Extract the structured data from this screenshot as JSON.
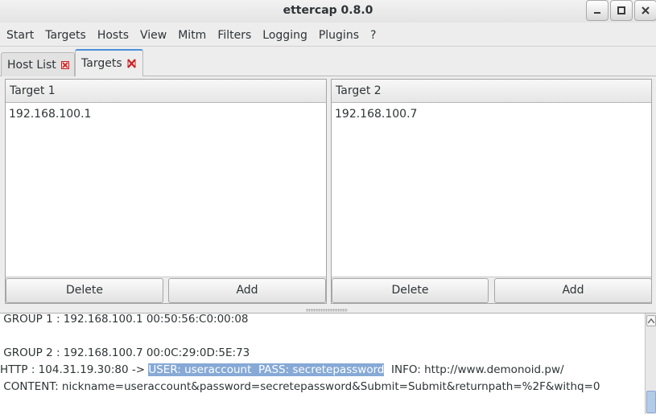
{
  "window": {
    "title": "ettercap 0.8.0",
    "controls": [
      "minimize-icon",
      "maximize-icon",
      "close-icon"
    ]
  },
  "menu": [
    "Start",
    "Targets",
    "Hosts",
    "View",
    "Mitm",
    "Filters",
    "Logging",
    "Plugins",
    "?"
  ],
  "tabs": [
    {
      "label": "Host List",
      "active": false
    },
    {
      "label": "Targets",
      "active": true
    }
  ],
  "target1": {
    "header": "Target 1",
    "items": [
      "192.168.100.1"
    ],
    "delete_label": "Delete",
    "add_label": "Add"
  },
  "target2": {
    "header": "Target 2",
    "items": [
      "192.168.100.7"
    ],
    "delete_label": "Delete",
    "add_label": "Add"
  },
  "console": {
    "line1": " GROUP 1 : 192.168.100.1 00:50:56:C0:00:08",
    "line2": " GROUP 2 : 192.168.100.7 00:0C:29:0D:5E:73",
    "line3_prefix": "HTTP : 104.31.19.30:80 -> ",
    "line3_highlight": "USER: useraccount  PASS: secretepassword",
    "line3_suffix": "  INFO: http://www.demonoid.pw/",
    "line4": " CONTENT: nickname=useraccount&password=secretepassword&Submit=Submit&returnpath=%2F&withq=0"
  },
  "colors": {
    "selection": "#86a9d6",
    "tab_close": "#cc2222",
    "active_tab_accent": "#4a90d9"
  }
}
